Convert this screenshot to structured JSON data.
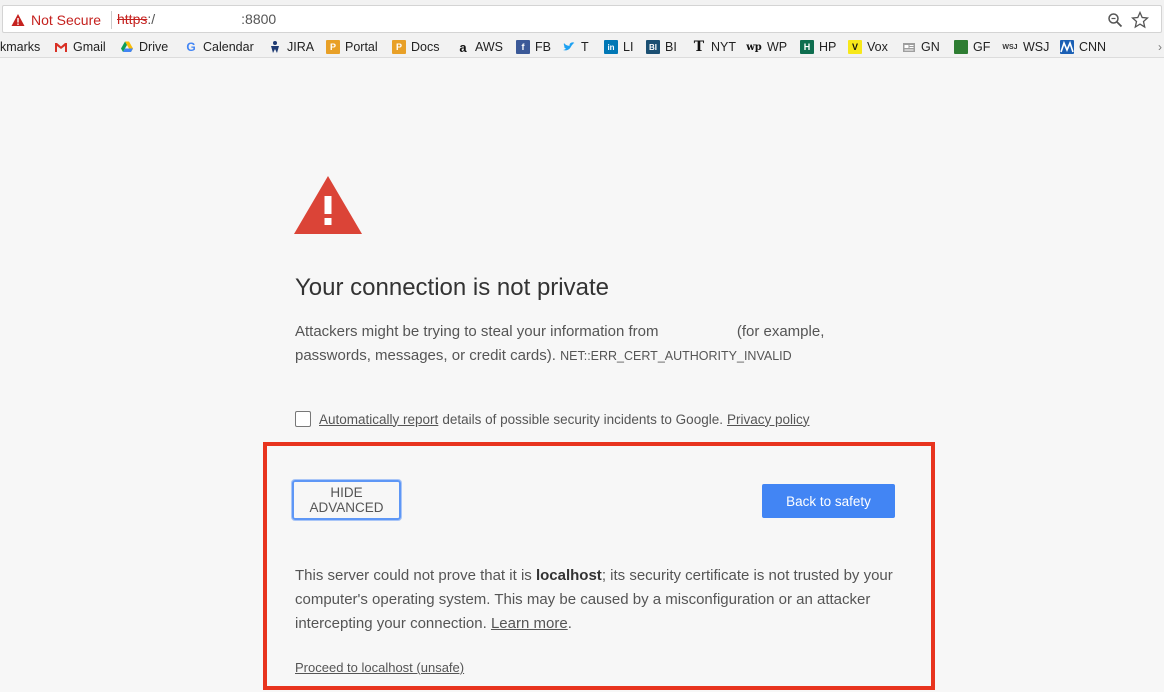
{
  "browser": {
    "security_label": "Not Secure",
    "url_scheme": "https",
    "url_sep": ":/",
    "url_port": ":8800"
  },
  "bookmarks": {
    "items": [
      {
        "label": "kmarks",
        "icon": "bookmarks-folder-icon"
      },
      {
        "label": "Gmail",
        "icon": "gmail-icon",
        "color": "#d93025"
      },
      {
        "label": "Drive",
        "icon": "drive-icon"
      },
      {
        "label": "Calendar",
        "icon": "google-icon"
      },
      {
        "label": "JIRA",
        "icon": "jira-icon"
      },
      {
        "label": "Portal",
        "icon": "portal-icon",
        "color": "#e8a027"
      },
      {
        "label": "Docs",
        "icon": "docs-icon",
        "color": "#e8a027"
      },
      {
        "label": "AWS",
        "icon": "amazon-icon"
      },
      {
        "label": "FB",
        "icon": "facebook-icon",
        "color": "#3b5998"
      },
      {
        "label": "T",
        "icon": "twitter-icon",
        "color": "#1da1f2"
      },
      {
        "label": "LI",
        "icon": "linkedin-icon",
        "color": "#0077b5"
      },
      {
        "label": "BI",
        "icon": "business-insider-icon",
        "color": "#1b4f72"
      },
      {
        "label": "NYT",
        "icon": "nyt-icon"
      },
      {
        "label": "WP",
        "icon": "washington-post-icon"
      },
      {
        "label": "HP",
        "icon": "huffpost-icon",
        "color": "#0e6e4f"
      },
      {
        "label": "Vox",
        "icon": "vox-icon",
        "color": "#f7e81a"
      },
      {
        "label": "GN",
        "icon": "google-news-icon"
      },
      {
        "label": "GF",
        "icon": "google-finance-icon",
        "color": "#2e7d32"
      },
      {
        "label": "WSJ",
        "icon": "wsj-icon"
      },
      {
        "label": "CNN",
        "icon": "cnn-icon",
        "color": "#1a5fb4"
      }
    ]
  },
  "interstitial": {
    "title": "Your connection is not private",
    "message_start": "Attackers might be trying to steal your information from",
    "message_end": "(for example,",
    "message_line2": "passwords, messages, or credit cards).",
    "error_code": "NET::ERR_CERT_AUTHORITY_INVALID",
    "report_link": "Automatically report",
    "report_text": "details of possible security incidents to Google.",
    "privacy_link": "Privacy policy",
    "hide_advanced": "HIDE ADVANCED",
    "back_to_safety": "Back to safety",
    "details_start": "This server could not prove that it is",
    "details_host": "localhost",
    "details_rest": "; its security certificate is not trusted by your computer's operating system. This may be caused by a misconfiguration or an attacker intercepting your connection.",
    "learn_more": "Learn more",
    "details_end": ".",
    "proceed_link": "Proceed to localhost (unsafe)"
  },
  "colors": {
    "accent_blue": "#4285f4",
    "warning_red": "#db4437",
    "annotation_red": "#e8341e"
  }
}
